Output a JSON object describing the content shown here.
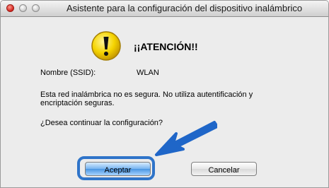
{
  "window": {
    "title": "Asistente para la configuración del dispositivo inalámbrico"
  },
  "alert": {
    "icon": "warning-exclamation-icon",
    "heading": "¡¡ATENCIÓN!!",
    "ssid_label": "Nombre (SSID):",
    "ssid_value": "WLAN",
    "message": "Esta red inalámbrica no es segura. No utiliza autentificación y encriptación seguras.",
    "question": "¿Desea continuar la configuración?"
  },
  "buttons": {
    "accept_label": "Aceptar",
    "cancel_label": "Cancelar"
  },
  "annotation": {
    "arrow_color": "#1f66c8",
    "highlight_color": "#2f74c9"
  }
}
